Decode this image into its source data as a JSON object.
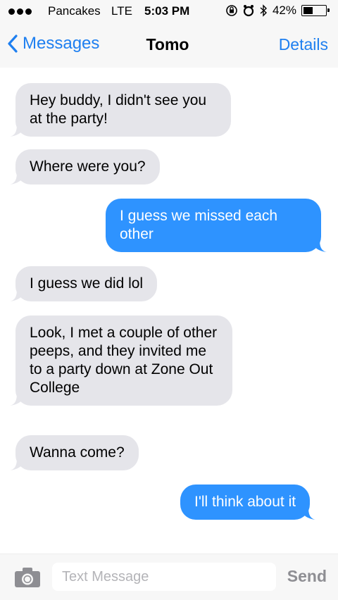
{
  "status_bar": {
    "carrier": "Pancakes",
    "network": "LTE",
    "time": "5:03 PM",
    "battery_percent": "42%",
    "battery_level": 0.42,
    "icons": [
      "orientation-lock-icon",
      "alarm-icon",
      "bluetooth-icon",
      "battery-icon"
    ]
  },
  "nav": {
    "back_label": "Messages",
    "title": "Tomo",
    "details_label": "Details",
    "accent_color": "#1e7ff0"
  },
  "messages": [
    {
      "direction": "incoming",
      "text": "Hey buddy, I didn't see you at the party!"
    },
    {
      "direction": "incoming",
      "text": "Where were you?"
    },
    {
      "direction": "outgoing",
      "text": "I guess we missed each other"
    },
    {
      "direction": "incoming",
      "text": "I guess we did lol"
    },
    {
      "direction": "incoming",
      "text": "Look, I met a couple of other peeps, and they invited me to a party down at Zone Out College"
    },
    {
      "direction": "incoming",
      "text": "Wanna come?"
    },
    {
      "direction": "outgoing",
      "text": "I'll think about it"
    }
  ],
  "input": {
    "placeholder": "Text Message",
    "value": "",
    "send_label": "Send"
  },
  "colors": {
    "incoming_bubble": "#e5e5ea",
    "outgoing_bubble": "#2e93ff",
    "bar_background": "#f7f7f7"
  }
}
